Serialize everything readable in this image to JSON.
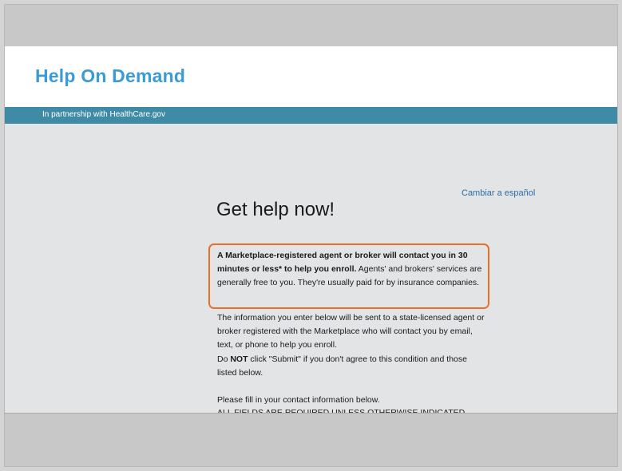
{
  "header": {
    "brand": "Help On Demand",
    "partner_text": "In partnership with HealthCare.gov"
  },
  "language_link": "Cambiar a español",
  "headline": "Get help now!",
  "intro": {
    "bold_text": "A Marketplace-registered agent or broker will contact you in 30 minutes or less* to help you enroll.",
    "rest_text": " Agents' and brokers' services are generally free to you. They're usually paid for by insurance companies."
  },
  "info_paragraph": "The information you enter below will be sent to a state-licensed agent or broker registered with the Marketplace who will contact you by email, text, or phone to help you enroll.",
  "warning": {
    "prefix": "Do ",
    "bold": "NOT",
    "suffix": " click \"Submit\" if you don't agree to this condition and those listed below."
  },
  "fill_in": "Please fill in your contact information below.",
  "required_note": "ALL FIELDS ARE REQUIRED UNLESS OTHERWISE INDICATED",
  "colors": {
    "brand": "#3a9bd6",
    "partner_bar": "#3f8ba6",
    "highlight_border": "#e8702a",
    "link": "#2a6ea8"
  }
}
